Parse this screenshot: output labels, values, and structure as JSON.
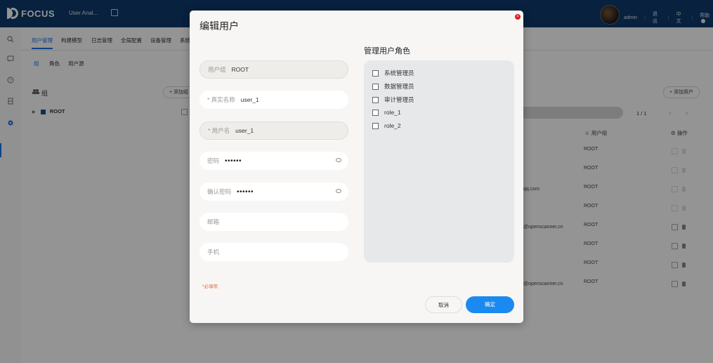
{
  "topbar": {
    "logo_text": "FOCUS",
    "app_name": "User Anal...",
    "user": "admin",
    "logout": "退出",
    "language": "中文",
    "help": "帮助"
  },
  "sidebar": {
    "icons": [
      "search-icon",
      "message-icon",
      "help-icon",
      "database-icon",
      "gear-icon"
    ],
    "active": "gear-icon"
  },
  "tabs": [
    "用户管理",
    "构建模型",
    "日志管理",
    "全局配置",
    "设备管理",
    "系统"
  ],
  "subtabs": [
    "组",
    "角色",
    "用户源"
  ],
  "background": {
    "group_title": "组",
    "add_group_label": "+ 添加组",
    "root_label": "ROOT",
    "add_user_label": "+ 添加用户",
    "pager": "1 / 1",
    "col_group": "用户组",
    "col_ops": "操作",
    "rows": [
      {
        "email": "",
        "group": "ROOT",
        "actions": "faded"
      },
      {
        "email": "",
        "group": "ROOT",
        "actions": "faded"
      },
      {
        "email": "qq.com",
        "group": "ROOT",
        "actions": "faded"
      },
      {
        "email": "",
        "group": "ROOT",
        "actions": "faded"
      },
      {
        "email": "@openscanner.cn",
        "group": "ROOT",
        "actions": "active"
      },
      {
        "email": "",
        "group": "ROOT",
        "actions": "active"
      },
      {
        "email": "",
        "group": "ROOT",
        "actions": "active"
      },
      {
        "email": "@openscanner.cn",
        "group": "ROOT",
        "actions": "active"
      }
    ]
  },
  "modal": {
    "title": "编辑用户",
    "fields": {
      "group": {
        "label": "用户组",
        "value": "ROOT"
      },
      "realname": {
        "label": "* 真实名称",
        "value": "user_1"
      },
      "username": {
        "label": "* 用户名",
        "value": "user_1"
      },
      "password": {
        "label": "密码",
        "value": "••••••"
      },
      "confirm": {
        "label": "确认密码",
        "value": "••••••"
      },
      "email": {
        "placeholder": "邮箱"
      },
      "phone": {
        "placeholder": "手机"
      }
    },
    "roles_title": "管理用户角色",
    "roles": [
      "系统管理员",
      "数据管理员",
      "审计管理员",
      "role_1",
      "role_2"
    ],
    "required_note": "*必填项",
    "cancel_label": "取消",
    "ok_label": "确定"
  },
  "colors": {
    "topbar": "#0d3a6b",
    "accent": "#1a8af0",
    "close": "#e02020"
  }
}
